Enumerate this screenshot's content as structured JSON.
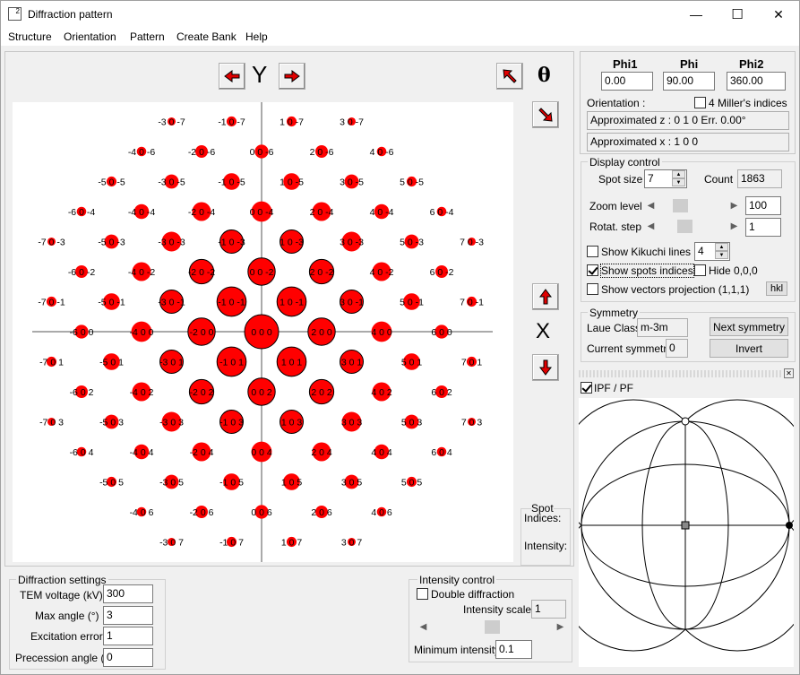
{
  "window": {
    "title": "Diffraction pattern",
    "app_icon_text": "2",
    "minimize_glyph": "—",
    "maximize_glyph": "☐",
    "close_glyph": "✕"
  },
  "menu": [
    "Structure",
    "Orientation",
    "Pattern",
    "Create Bank",
    "Help"
  ],
  "toolbar": {
    "axis_label": "Y",
    "theta_label": "θ",
    "x_marker": "X"
  },
  "orientation": {
    "phi1_label": "Phi1",
    "phi_label": "Phi",
    "phi2_label": "Phi2",
    "phi1": "0.00",
    "phi": "90.00",
    "phi2": "360.00",
    "orientation_label": "Orientation :",
    "miller4_label": "4 Miller's indices",
    "approx_z": "Approximated z : 0 1 0  Err. 0.00°",
    "approx_x": "Approximated x : 1 0 0"
  },
  "display_control": {
    "title": "Display control",
    "spot_size_label": "Spot size",
    "spot_size": "7",
    "count_label": "Count",
    "count": "1863",
    "zoom_label": "Zoom level",
    "zoom": "100",
    "rotat_label": "Rotat. step",
    "rotat": "1",
    "kikuchi_label": "Show Kikuchi lines",
    "kikuchi_value": "4",
    "spots_indices_label": "Show spots indices",
    "hide000_label": "Hide 0,0,0",
    "vectors_label": "Show vectors projection (1,1,1)",
    "hkl_label": "hkl",
    "zoom_level_pct": 0.27,
    "rotat_level_pct": 0.35
  },
  "symmetry": {
    "title": "Symmetry",
    "laue_label": "Laue Class",
    "laue": "m-3m",
    "current_label": "Current symmetry",
    "current": "0",
    "next_button": "Next symmetry",
    "invert_button": "Invert"
  },
  "ipf": {
    "label": "IPF / PF",
    "close_glyph": "✕"
  },
  "spot_info": {
    "title": "Spot",
    "indices_label": "Indices:",
    "intensity_label": "Intensity:"
  },
  "diffraction_settings": {
    "title": "Diffraction settings",
    "voltage_label": "TEM voltage (kV)",
    "voltage": "300",
    "max_angle_label": "Max angle  (°)",
    "max_angle": "3",
    "excitation_label": "Excitation error",
    "excitation": "1",
    "precession_label": "Precession angle (°)",
    "precession": "0"
  },
  "intensity_control": {
    "title": "Intensity control",
    "double_label": "Double diffraction",
    "scale_label": "Intensity scale",
    "scale": "1",
    "min_label": "Minimum intensity",
    "min": "0.1",
    "scale_level_pct": 0.5
  },
  "colors": {
    "spot": "#ff0000",
    "arrow": "#e00000"
  },
  "pattern": {
    "labels": [
      {
        "h": -3,
        "l": -7,
        "t": "-3 0 -7"
      },
      {
        "h": -1,
        "l": -7,
        "t": "-1 0 -7"
      },
      {
        "h": 1,
        "l": -7,
        "t": "1 0 -7"
      },
      {
        "h": 3,
        "l": -7,
        "t": "3 0 -7"
      },
      {
        "h": -4,
        "l": -6,
        "t": "-4 0 -6"
      },
      {
        "h": -2,
        "l": -6,
        "t": "-2 0 -6"
      },
      {
        "h": 0,
        "l": -6,
        "t": "0 0 -6"
      },
      {
        "h": 2,
        "l": -6,
        "t": "2 0 -6"
      },
      {
        "h": 4,
        "l": -6,
        "t": "4 0 -6"
      },
      {
        "h": -5,
        "l": -5,
        "t": "-5 0 -5"
      },
      {
        "h": -3,
        "l": -5,
        "t": "-3 0 -5"
      },
      {
        "h": -1,
        "l": -5,
        "t": "-1 0 -5"
      },
      {
        "h": 1,
        "l": -5,
        "t": "1 0 -5"
      },
      {
        "h": 3,
        "l": -5,
        "t": "3 0 -5"
      },
      {
        "h": 5,
        "l": -5,
        "t": "5 0 -5"
      },
      {
        "h": -6,
        "l": -4,
        "t": "-6 0 -4"
      },
      {
        "h": -4,
        "l": -4,
        "t": "-4 0 -4"
      },
      {
        "h": -2,
        "l": -4,
        "t": "-2 0 -4"
      },
      {
        "h": 0,
        "l": -4,
        "t": "0 0 -4"
      },
      {
        "h": 2,
        "l": -4,
        "t": "2 0 -4"
      },
      {
        "h": 4,
        "l": -4,
        "t": "4 0 -4"
      },
      {
        "h": 6,
        "l": -4,
        "t": "6 0 -4"
      },
      {
        "h": -7,
        "l": -3,
        "t": "-7 0 -3"
      },
      {
        "h": -5,
        "l": -3,
        "t": "-5 0 -3"
      },
      {
        "h": -3,
        "l": -3,
        "t": "-3 0 -3"
      },
      {
        "h": -1,
        "l": -3,
        "t": "-1 0 -3"
      },
      {
        "h": 1,
        "l": -3,
        "t": "1 0 -3"
      },
      {
        "h": 3,
        "l": -3,
        "t": "3 0 -3"
      },
      {
        "h": 5,
        "l": -3,
        "t": "5 0 -3"
      },
      {
        "h": 7,
        "l": -3,
        "t": "7 0 -3"
      },
      {
        "h": -6,
        "l": -2,
        "t": "-6 0 -2"
      },
      {
        "h": -4,
        "l": -2,
        "t": "-4 0 -2"
      },
      {
        "h": -2,
        "l": -2,
        "t": "-2 0 -2"
      },
      {
        "h": 0,
        "l": -2,
        "t": "0 0 -2"
      },
      {
        "h": 2,
        "l": -2,
        "t": "2 0 -2"
      },
      {
        "h": 4,
        "l": -2,
        "t": "4 0 -2"
      },
      {
        "h": 6,
        "l": -2,
        "t": "6 0 -2"
      },
      {
        "h": -7,
        "l": -1,
        "t": "-7 0 -1"
      },
      {
        "h": -5,
        "l": -1,
        "t": "-5 0 -1"
      },
      {
        "h": -3,
        "l": -1,
        "t": "-3 0 -1"
      },
      {
        "h": -1,
        "l": -1,
        "t": "-1 0 -1"
      },
      {
        "h": 1,
        "l": -1,
        "t": "1 0 -1"
      },
      {
        "h": 3,
        "l": -1,
        "t": "3 0 -1"
      },
      {
        "h": 5,
        "l": -1,
        "t": "5 0 -1"
      },
      {
        "h": 7,
        "l": -1,
        "t": "7 0 -1"
      },
      {
        "h": -6,
        "l": 0,
        "t": "-6 0 0"
      },
      {
        "h": -4,
        "l": 0,
        "t": "-4 0 0"
      },
      {
        "h": -2,
        "l": 0,
        "t": "-2 0 0"
      },
      {
        "h": 0,
        "l": 0,
        "t": "0 0 0"
      },
      {
        "h": 2,
        "l": 0,
        "t": "2 0 0"
      },
      {
        "h": 4,
        "l": 0,
        "t": "4 0 0"
      },
      {
        "h": 6,
        "l": 0,
        "t": "6 0 0"
      },
      {
        "h": -7,
        "l": 1,
        "t": "-7 0 1"
      },
      {
        "h": -5,
        "l": 1,
        "t": "-5 0 1"
      },
      {
        "h": -3,
        "l": 1,
        "t": "-3 0 1"
      },
      {
        "h": -1,
        "l": 1,
        "t": "-1 0 1"
      },
      {
        "h": 1,
        "l": 1,
        "t": "1 0 1"
      },
      {
        "h": 3,
        "l": 1,
        "t": "3 0 1"
      },
      {
        "h": 5,
        "l": 1,
        "t": "5 0 1"
      },
      {
        "h": 7,
        "l": 1,
        "t": "7 0 1"
      },
      {
        "h": -6,
        "l": 2,
        "t": "-6 0 2"
      },
      {
        "h": -4,
        "l": 2,
        "t": "-4 0 2"
      },
      {
        "h": -2,
        "l": 2,
        "t": "-2 0 2"
      },
      {
        "h": 0,
        "l": 2,
        "t": "0 0 2"
      },
      {
        "h": 2,
        "l": 2,
        "t": "2 0 2"
      },
      {
        "h": 4,
        "l": 2,
        "t": "4 0 2"
      },
      {
        "h": 6,
        "l": 2,
        "t": "6 0 2"
      },
      {
        "h": -7,
        "l": 3,
        "t": "-7 0 3"
      },
      {
        "h": -5,
        "l": 3,
        "t": "-5 0 3"
      },
      {
        "h": -3,
        "l": 3,
        "t": "-3 0 3"
      },
      {
        "h": -1,
        "l": 3,
        "t": "-1 0 3"
      },
      {
        "h": 1,
        "l": 3,
        "t": "1 0 3"
      },
      {
        "h": 3,
        "l": 3,
        "t": "3 0 3"
      },
      {
        "h": 5,
        "l": 3,
        "t": "5 0 3"
      },
      {
        "h": 7,
        "l": 3,
        "t": "7 0 3"
      },
      {
        "h": -6,
        "l": 4,
        "t": "-6 0 4"
      },
      {
        "h": -4,
        "l": 4,
        "t": "-4 0 4"
      },
      {
        "h": -2,
        "l": 4,
        "t": "-2 0 4"
      },
      {
        "h": 0,
        "l": 4,
        "t": "0 0 4"
      },
      {
        "h": 2,
        "l": 4,
        "t": "2 0 4"
      },
      {
        "h": 4,
        "l": 4,
        "t": "4 0 4"
      },
      {
        "h": 6,
        "l": 4,
        "t": "6 0 4"
      },
      {
        "h": -5,
        "l": 5,
        "t": "-5 0 5"
      },
      {
        "h": -3,
        "l": 5,
        "t": "-3 0 5"
      },
      {
        "h": -1,
        "l": 5,
        "t": "-1 0 5"
      },
      {
        "h": 1,
        "l": 5,
        "t": "1 0 5"
      },
      {
        "h": 3,
        "l": 5,
        "t": "3 0 5"
      },
      {
        "h": 5,
        "l": 5,
        "t": "5 0 5"
      },
      {
        "h": -4,
        "l": 6,
        "t": "-4 0 6"
      },
      {
        "h": -2,
        "l": 6,
        "t": "-2 0 6"
      },
      {
        "h": 0,
        "l": 6,
        "t": "0 0 6"
      },
      {
        "h": 2,
        "l": 6,
        "t": "2 0 6"
      },
      {
        "h": 4,
        "l": 6,
        "t": "4 0 6"
      },
      {
        "h": -3,
        "l": 7,
        "t": "-3 0 7"
      },
      {
        "h": -1,
        "l": 7,
        "t": "-1 0 7"
      },
      {
        "h": 1,
        "l": 7,
        "t": "1 0 7"
      },
      {
        "h": 3,
        "l": 7,
        "t": "3 0 7"
      }
    ]
  }
}
